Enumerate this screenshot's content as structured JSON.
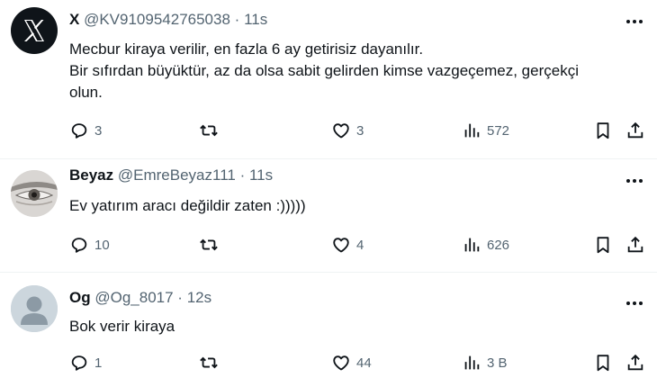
{
  "tweets": [
    {
      "name": "X",
      "handle": "@KV9109542765038",
      "separator": "·",
      "time": "11s",
      "lines": [
        "Mecbur kiraya verilir, en fazla 6 ay getirisiz dayanılır.",
        "Bir sıfırdan büyüktür, az da olsa sabit gelirden kimse vazgeçemez, gerçekçi",
        "olun."
      ],
      "replies": "3",
      "retweets": "",
      "likes": "3",
      "views": "572"
    },
    {
      "name": "Beyaz",
      "handle": "@EmreBeyaz111",
      "separator": "·",
      "time": "11s",
      "lines": [
        "Ev yatırım aracı değildir zaten :)))))"
      ],
      "replies": "10",
      "retweets": "",
      "likes": "4",
      "views": "626"
    },
    {
      "name": "Og",
      "handle": "@Og_8017",
      "separator": "·",
      "time": "12s",
      "lines": [
        "Bok verir kiraya"
      ],
      "replies": "1",
      "retweets": "",
      "likes": "44",
      "views": "3 B"
    }
  ],
  "icons": {
    "more": "more-icon",
    "reply": "reply-icon",
    "retweet": "retweet-icon",
    "like": "like-icon",
    "views": "views-icon",
    "bookmark": "bookmark-icon",
    "share": "share-icon"
  },
  "colors": {
    "text": "#0f1419",
    "muted": "#536471",
    "divider": "#eff3f4",
    "x_avatar_bg": "#0f1419",
    "default_avatar_bg": "#ccd6dd"
  }
}
